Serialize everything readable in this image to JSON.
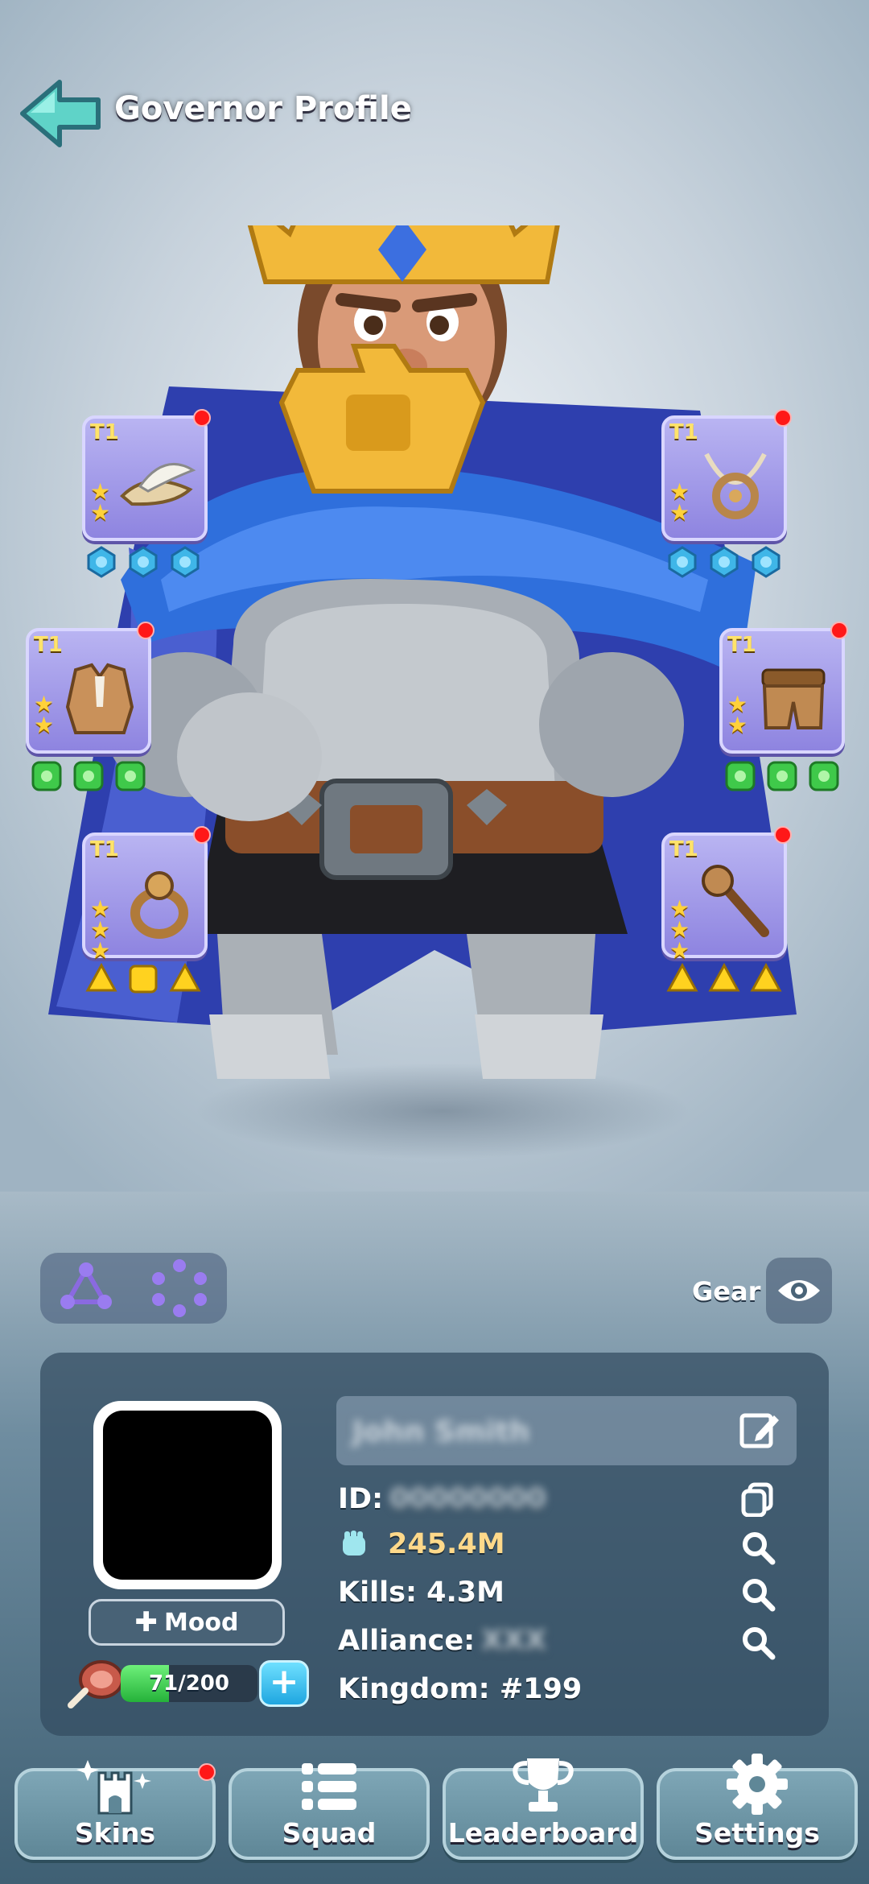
{
  "header": {
    "title": "Governor Profile"
  },
  "equipment": {
    "slots": [
      {
        "tier": "T1",
        "stars": 2,
        "item": "feathered-hat",
        "gems": "blue"
      },
      {
        "tier": "T1",
        "stars": 2,
        "item": "necklace",
        "gems": "blue"
      },
      {
        "tier": "T1",
        "stars": 2,
        "item": "armor-vest",
        "gems": "green"
      },
      {
        "tier": "T1",
        "stars": 2,
        "item": "belt-pants",
        "gems": "green"
      },
      {
        "tier": "T1",
        "stars": 3,
        "item": "ring",
        "gems": "yellow"
      },
      {
        "tier": "T1",
        "stars": 3,
        "item": "scepter",
        "gems": "yellow"
      }
    ]
  },
  "controls": {
    "gear_label": "Gear"
  },
  "profile": {
    "name": "John Smith",
    "mood_label": "Mood",
    "stamina_text": "71/200",
    "stamina_fraction": 0.355,
    "id_label": "ID:",
    "id_value": "00000000",
    "power_value": "245.4M",
    "kills_text": "Kills: 4.3M",
    "alliance_label": "Alliance:",
    "alliance_value": "XXX",
    "kingdom_text": "Kingdom: #199"
  },
  "nav": {
    "items": [
      {
        "label": "Skins",
        "icon": "castle-icon"
      },
      {
        "label": "Squad",
        "icon": "list-icon"
      },
      {
        "label": "Leaderboard",
        "icon": "trophy-icon"
      },
      {
        "label": "Settings",
        "icon": "gear-icon"
      }
    ]
  },
  "colors": {
    "accent_purple": "#9a90e6",
    "notification": "#ff1818",
    "power": "#ffd98a"
  }
}
